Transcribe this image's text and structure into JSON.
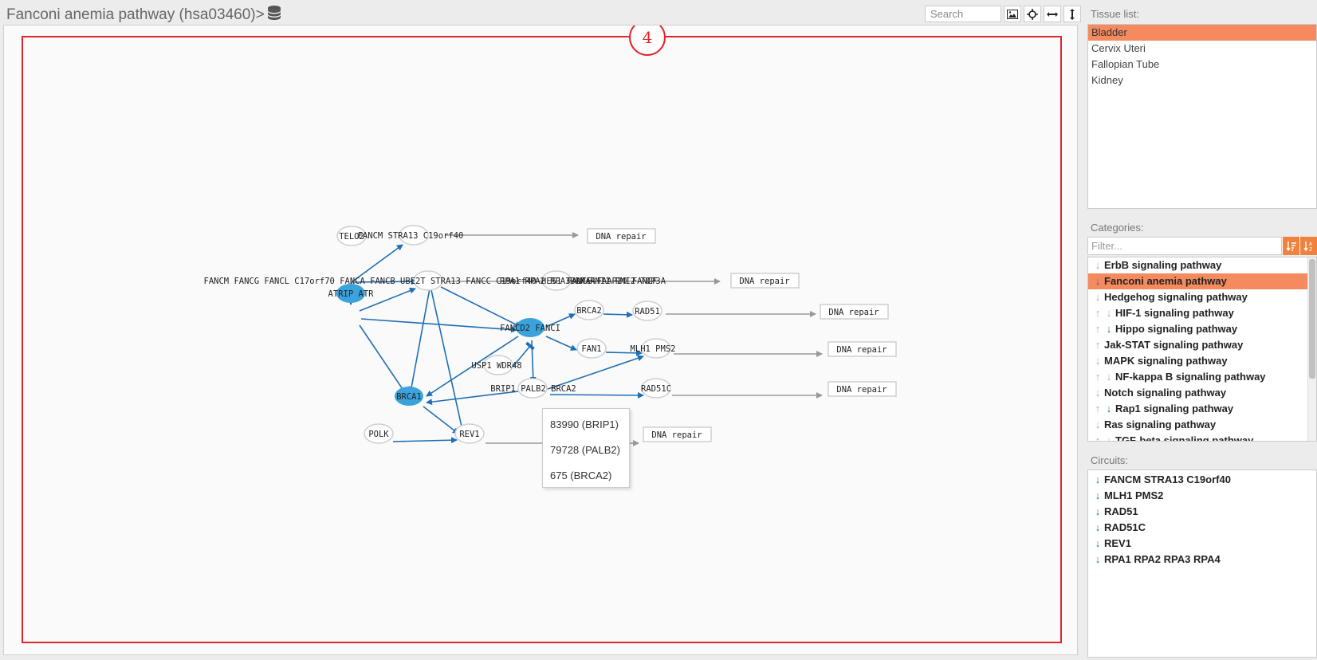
{
  "header": {
    "title": "Fanconi anemia pathway (hsa03460)>",
    "search_placeholder": "Search"
  },
  "toolbar": {
    "icons": [
      "image-icon",
      "crosshair-icon",
      "fit-width-icon",
      "fit-height-icon"
    ]
  },
  "colors": {
    "accent": "#f58a5e",
    "sort_button": "#f0823f",
    "node_active": "#3ba3dc",
    "edge": "#1f6fb5",
    "frame": "#e0252b"
  },
  "graph": {
    "badge": "4",
    "nodes": [
      {
        "label": "TELO2"
      },
      {
        "label": "FANCM STRA13 C19orf40"
      },
      {
        "label": "FANCM FANCG FANCL C17orf70 FANCA FANCB UBE2T STRA13 FANCC C19orf40 HES1 FANCE FAAP20 FANCF"
      },
      {
        "label": "ATRIP ATR"
      },
      {
        "label": "RPA1 RPA2 RPA3 RPA4"
      },
      {
        "label": "BLM RMI1 RMI2 TOP3A"
      },
      {
        "label": "BRCA2"
      },
      {
        "label": "RAD51"
      },
      {
        "label": "FANCD2 FANCI"
      },
      {
        "label": "FAN1"
      },
      {
        "label": "MLH1 PMS2"
      },
      {
        "label": "USP1 WDR48"
      },
      {
        "label": "BRCA1"
      },
      {
        "label": "BRIP1 PALB2 BRCA2"
      },
      {
        "label": "RAD51C"
      },
      {
        "label": "POLK"
      },
      {
        "label": "REV1"
      }
    ],
    "outputs": [
      "DNA repair",
      "DNA repair",
      "DNA repair",
      "DNA repair",
      "DNA repair",
      "DNA repair"
    ]
  },
  "tooltip": {
    "items": [
      "83990 (BRIP1)",
      "79728 (PALB2)",
      "675 (BRCA2)"
    ]
  },
  "tissue": {
    "label": "Tissue list:",
    "items": [
      "Bladder",
      "Cervix Uteri",
      "Fallopian Tube",
      "Kidney"
    ],
    "selected": "Bladder"
  },
  "categories": {
    "label": "Categories:",
    "filter_placeholder": "Filter...",
    "sort_icons": [
      "sort-desc-icon",
      "sort-asc-icon"
    ],
    "items": [
      {
        "label": "ErbB signaling pathway",
        "arrows": [
          "down-grey"
        ]
      },
      {
        "label": "Fanconi anemia pathway",
        "arrows": [
          "down-blue"
        ],
        "selected": true
      },
      {
        "label": "Hedgehog signaling pathway",
        "arrows": [
          "down-grey"
        ]
      },
      {
        "label": "HIF-1 signaling pathway",
        "arrows": [
          "up-grey",
          "down-grey"
        ]
      },
      {
        "label": "Hippo signaling pathway",
        "arrows": [
          "up-grey",
          "down-blue"
        ]
      },
      {
        "label": "Jak-STAT signaling pathway",
        "arrows": [
          "up-grey"
        ]
      },
      {
        "label": "MAPK signaling pathway",
        "arrows": [
          "down-grey"
        ]
      },
      {
        "label": "NF-kappa B signaling pathway",
        "arrows": [
          "up-grey",
          "down-grey"
        ]
      },
      {
        "label": "Notch signaling pathway",
        "arrows": [
          "down-grey"
        ]
      },
      {
        "label": "Rap1 signaling pathway",
        "arrows": [
          "up-grey",
          "down-blue"
        ]
      },
      {
        "label": "Ras signaling pathway",
        "arrows": [
          "down-grey"
        ]
      },
      {
        "label": "TGF-beta signaling pathway",
        "arrows": [
          "up-grey",
          "down-grey"
        ]
      }
    ]
  },
  "circuits": {
    "label": "Circuits:",
    "items": [
      "FANCM STRA13 C19orf40",
      "MLH1 PMS2",
      "RAD51",
      "RAD51C",
      "REV1",
      "RPA1 RPA2 RPA3 RPA4"
    ]
  }
}
